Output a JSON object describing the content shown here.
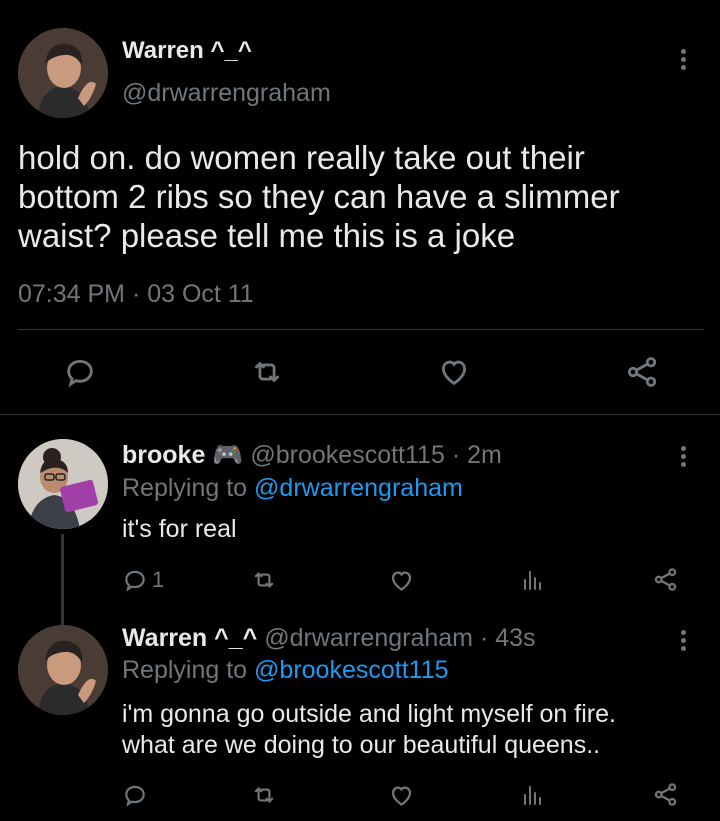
{
  "main_tweet": {
    "display_name": "Warren ^_^",
    "handle": "@drwarrengraham",
    "text_lines": [
      "hold on. do women really take out their",
      "bottom 2 ribs so they can have a slimmer",
      "waist? please tell me this is a joke"
    ],
    "timestamp": "07:34 PM · 03 Oct 11"
  },
  "replies": [
    {
      "display_name": "brooke 🎮",
      "handle": "@brookescott115",
      "time": "· 2m",
      "replying_prefix": "Replying to",
      "replying_to": "@drwarrengraham",
      "text_lines": [
        "it's for real"
      ],
      "reply_count": "1"
    },
    {
      "display_name": "Warren ^_^",
      "handle": "@drwarrengraham",
      "time": "· 43s",
      "replying_prefix": "Replying to",
      "replying_to": "@brookescott115",
      "text_lines": [
        "i'm gonna go outside and light myself on fire.",
        "what are we doing to our beautiful queens.."
      ],
      "reply_count": ""
    }
  ],
  "icons": {
    "reply": "reply-icon",
    "retweet": "retweet-icon",
    "like": "heart-icon",
    "share": "share-icon",
    "views": "analytics-icon",
    "more": "more-icon"
  },
  "colors": {
    "background": "#000000",
    "text": "#e7e9ea",
    "muted": "#71767b",
    "link": "#1d9bf0",
    "divider": "#2f3336"
  }
}
